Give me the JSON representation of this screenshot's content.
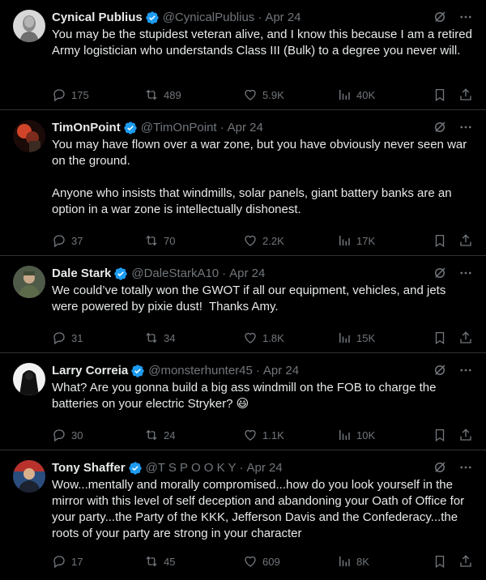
{
  "tweets": [
    {
      "name": "Cynical Publius",
      "handle": "@CynicalPublius",
      "time": "Apr 24",
      "text": "You may be the stupidest veteran alive, and I know this because I am a retired Army logistician who understands Class III (Bulk) to a degree you never will.",
      "replies": "175",
      "reposts": "489",
      "likes": "5.9K",
      "views": "40K"
    },
    {
      "name": "TimOnPoint",
      "handle": "@TimOnPoint",
      "time": "Apr 24",
      "text": "You may have flown over a war zone, but you have obviously never seen war on the ground.\n\nAnyone who insists that windmills, solar panels, giant battery banks are an option in a war zone is intellectually dishonest.",
      "replies": "37",
      "reposts": "70",
      "likes": "2.2K",
      "views": "17K"
    },
    {
      "name": "Dale Stark",
      "handle": "@DaleStarkA10",
      "time": "Apr 24",
      "text": "We could’ve totally won the GWOT if all our equipment, vehicles, and jets were powered by pixie dust!  Thanks Amy.",
      "replies": "31",
      "reposts": "34",
      "likes": "1.8K",
      "views": "15K"
    },
    {
      "name": "Larry Correia",
      "handle": "@monsterhunter45",
      "time": "Apr 24",
      "text": "What? Are you gonna build a big ass windmill on the FOB to charge the batteries on your electric Stryker? 😃",
      "replies": "30",
      "reposts": "24",
      "likes": "1.1K",
      "views": "10K"
    },
    {
      "name": "Tony Shaffer",
      "handle": "@T S P O O K Y",
      "time": "Apr 24",
      "text": "Wow...mentally and morally compromised...how do you look yourself in the mirror with this level of self deception and abandoning your Oath of Office for your party...the Party of the KKK, Jefferson Davis and the Confederacy...the roots of your party are strong in your character",
      "replies": "17",
      "reposts": "45",
      "likes": "609",
      "views": "8K"
    }
  ],
  "colors": {
    "background": "#000000",
    "text": "#e7e9ea",
    "muted": "#71767b",
    "verified": "#1d9bf0",
    "divider": "#2f3336"
  }
}
